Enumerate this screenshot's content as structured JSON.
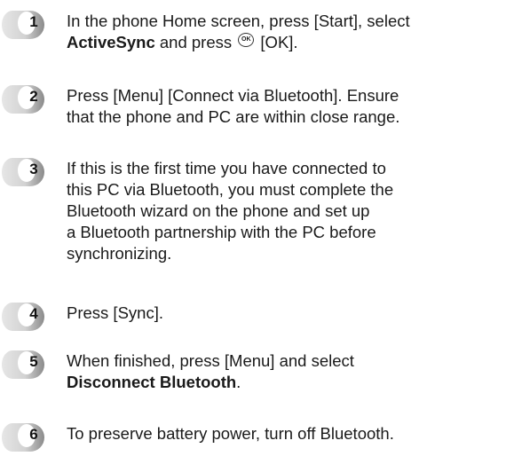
{
  "steps": [
    {
      "number": "1",
      "lines": [
        [
          {
            "t": "In the phone Home screen, press [Start], select"
          }
        ],
        [
          {
            "t": "ActiveSync",
            "b": true
          },
          {
            "t": " and press "
          },
          {
            "icon": "ok-button-icon",
            "label": "OK"
          },
          {
            "t": " [OK]."
          }
        ]
      ]
    },
    {
      "number": "2",
      "lines": [
        [
          {
            "t": "Press [Menu] [Connect via Bluetooth]. Ensure"
          }
        ],
        [
          {
            "t": "that the phone and PC are within close range."
          }
        ]
      ]
    },
    {
      "number": "3",
      "lines": [
        [
          {
            "t": "If this is the first time you have connected to"
          }
        ],
        [
          {
            "t": "this PC via Bluetooth, you must complete the"
          }
        ],
        [
          {
            "t": "Bluetooth wizard on the phone and set up"
          }
        ],
        [
          {
            "t": "a Bluetooth partnership with the PC before"
          }
        ],
        [
          {
            "t": "synchronizing."
          }
        ]
      ]
    },
    {
      "number": "4",
      "lines": [
        [
          {
            "t": "Press [Sync]."
          }
        ]
      ]
    },
    {
      "number": "5",
      "lines": [
        [
          {
            "t": "When finished, press [Menu] and select"
          }
        ],
        [
          {
            "t": "Disconnect Bluetooth",
            "b": true
          },
          {
            "t": "."
          }
        ]
      ]
    },
    {
      "number": "6",
      "lines": [
        [
          {
            "t": "To preserve battery power, turn off Bluetooth."
          }
        ]
      ]
    }
  ],
  "colors": {
    "badge_light": "#e6e6e6",
    "badge_dark": "#8a8a8a",
    "text": "#1a1a1a"
  }
}
